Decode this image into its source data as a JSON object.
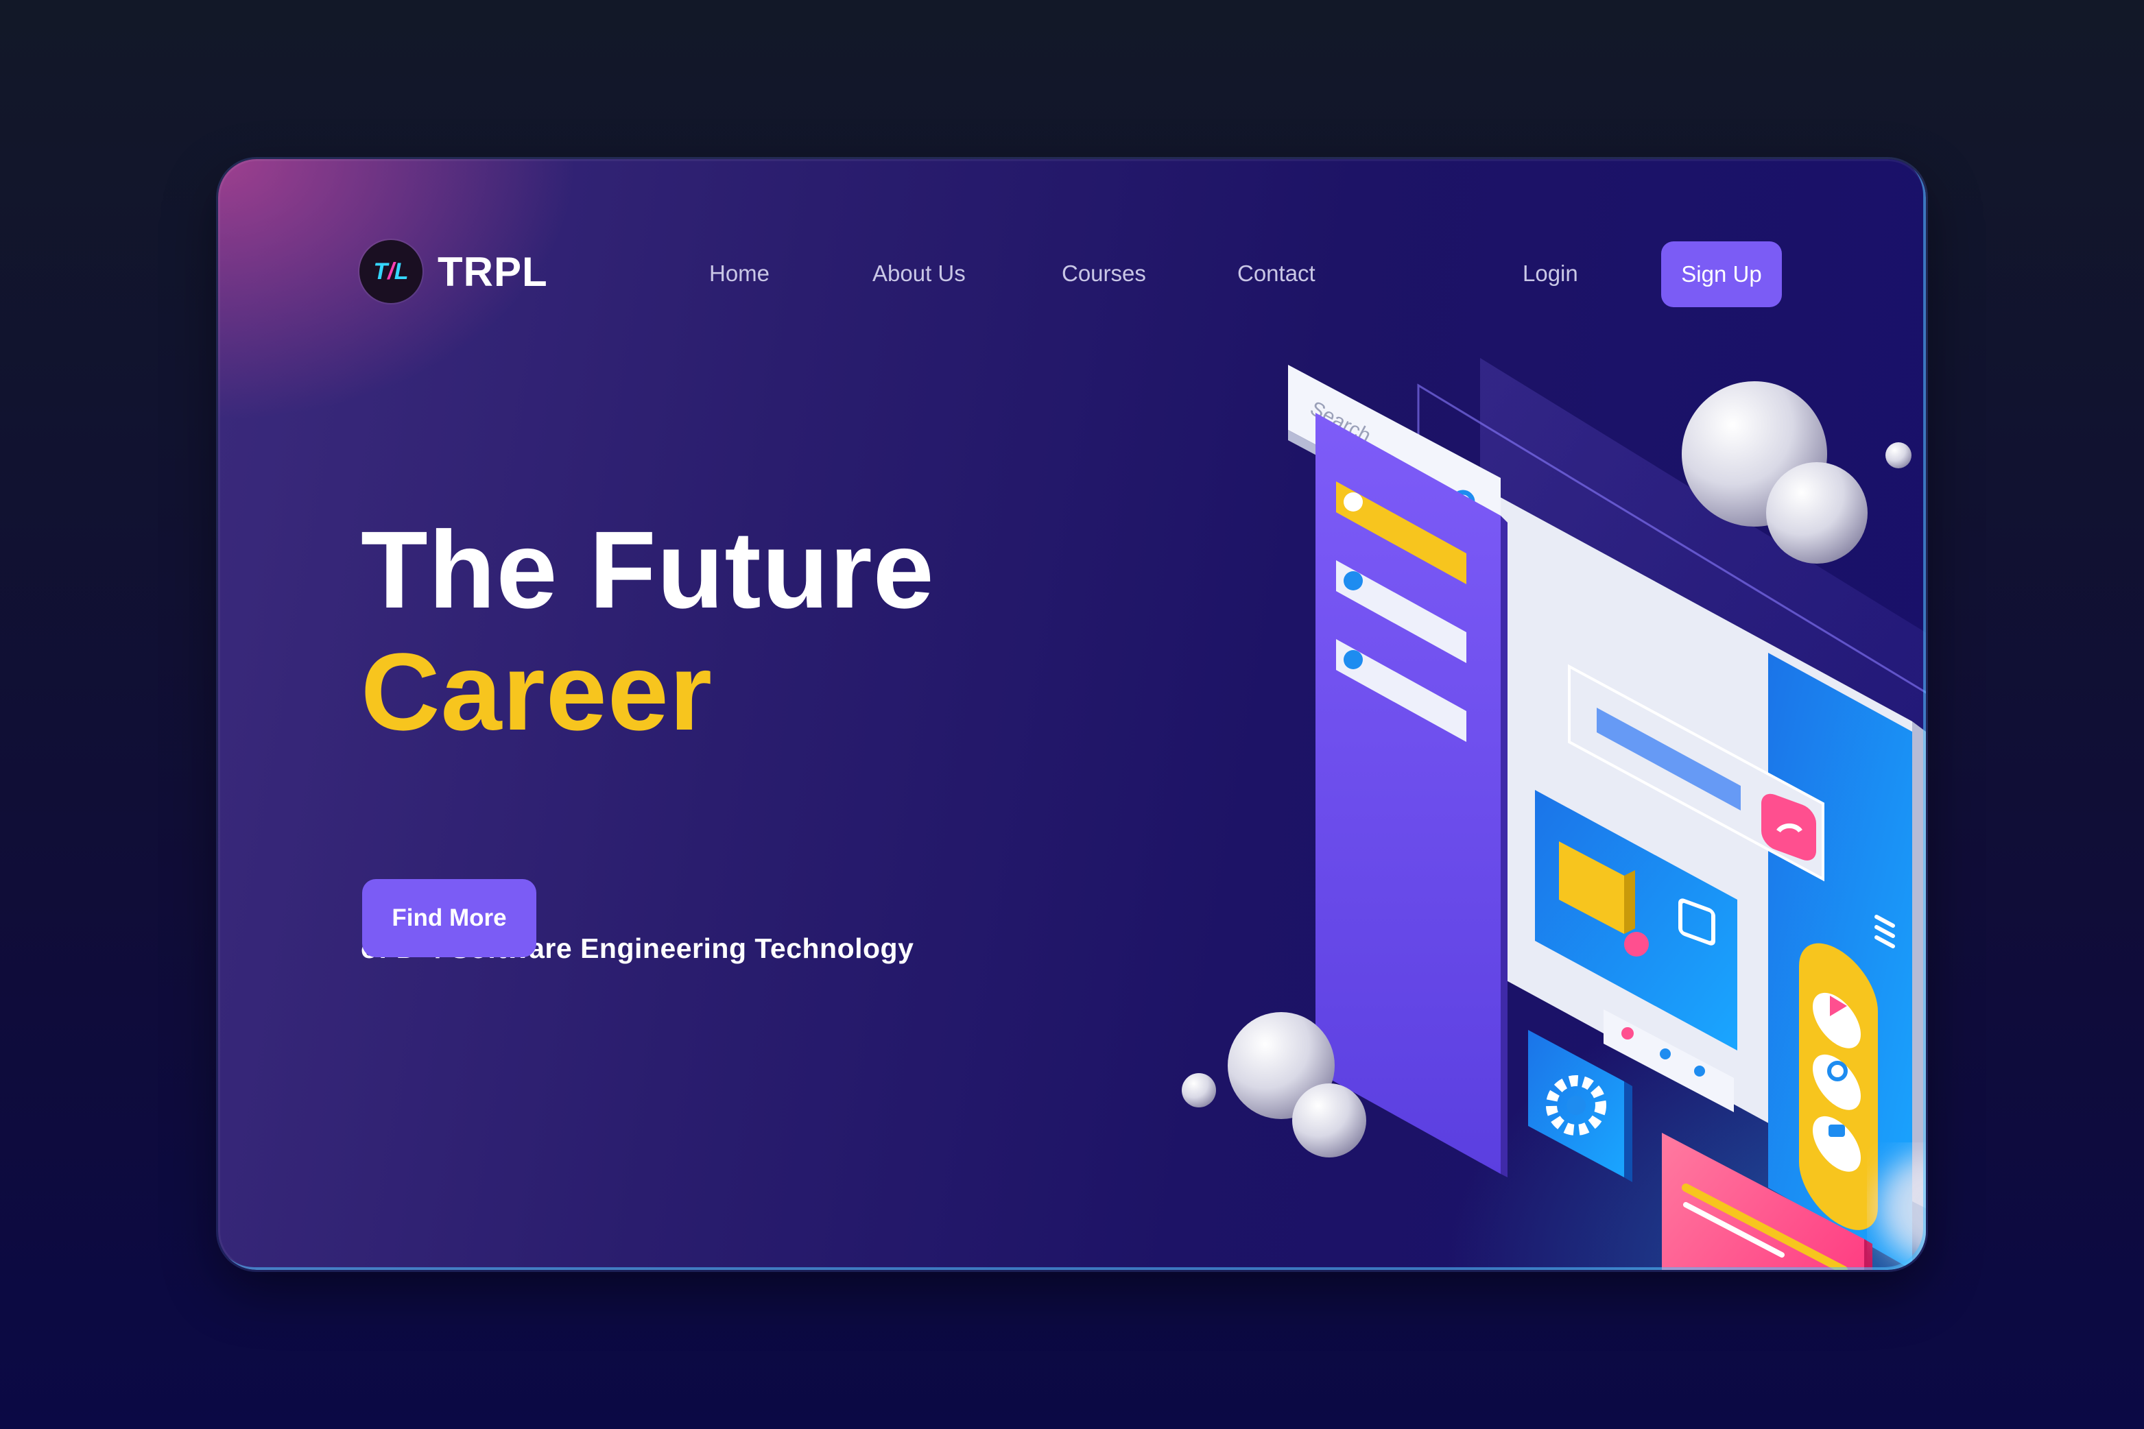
{
  "brand": {
    "name": "TRPL",
    "logo_mark": "TRPL"
  },
  "nav": {
    "links": [
      {
        "label": "Home"
      },
      {
        "label": "About Us"
      },
      {
        "label": "Courses"
      },
      {
        "label": "Contact"
      }
    ],
    "login_label": "Login",
    "signup_label": "Sign Up"
  },
  "hero": {
    "title": "The Future",
    "title_accent": "Career",
    "subtitle": "of D-4 Software Engineering Technology",
    "cta_label": "Find More"
  },
  "illustration": {
    "search_placeholder": "Search"
  },
  "colors": {
    "accent": "#7b5cf5",
    "highlight": "#f7c51e",
    "pink": "#ff4f8f",
    "blue": "#1e8cf0"
  }
}
